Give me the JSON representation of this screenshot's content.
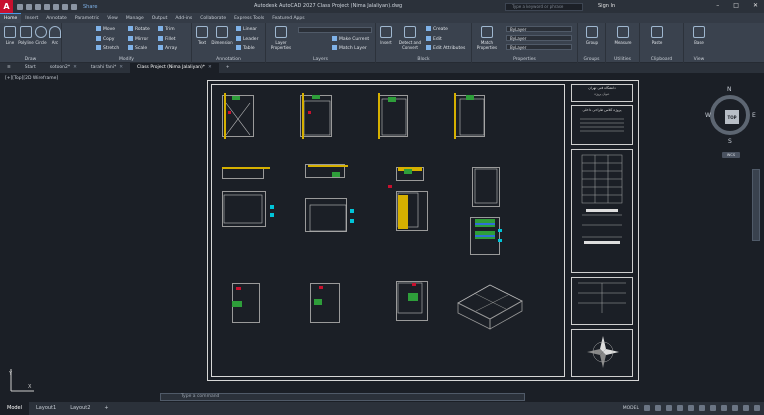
{
  "app": {
    "title": "Autodesk AutoCAD 2027   Class Project (Nima Jalaliyan).dwg",
    "logo": "A",
    "share": "Share",
    "search_placeholder": "Type a keyword or phrase",
    "signin": "Sign In"
  },
  "ribbon_tabs": [
    "Home",
    "Insert",
    "Annotate",
    "Parametric",
    "View",
    "Manage",
    "Output",
    "Add-ins",
    "Collaborate",
    "Express Tools",
    "Featured Apps"
  ],
  "panels": {
    "draw": {
      "title": "Draw",
      "tools": [
        "Line",
        "Polyline",
        "Circle",
        "Arc"
      ]
    },
    "modify": {
      "title": "Modify",
      "tools": [
        "Move",
        "Rotate",
        "Trim",
        "Copy",
        "Mirror",
        "Fillet",
        "Stretch",
        "Scale",
        "Array"
      ]
    },
    "annotation": {
      "title": "Annotation",
      "tools": [
        "Text",
        "Dimension",
        "Linear",
        "Leader",
        "Table"
      ]
    },
    "layers": {
      "title": "Layers",
      "tools": [
        "Layer Properties",
        "Make Current",
        "Match Layer"
      ]
    },
    "block": {
      "title": "Block",
      "tools": [
        "Insert",
        "Detect and Convert",
        "Create",
        "Edit",
        "Edit Attributes"
      ]
    },
    "properties": {
      "title": "Properties",
      "tools": [
        "Match Properties",
        "ByLayer",
        "ByLayer",
        "ByLayer"
      ]
    },
    "groups": {
      "title": "Groups",
      "tools": [
        "Group"
      ]
    },
    "utilities": {
      "title": "Utilities",
      "tools": [
        "Measure"
      ]
    },
    "clipboard": {
      "title": "Clipboard",
      "tools": [
        "Paste"
      ]
    },
    "view": {
      "title": "View",
      "tools": [
        "Base"
      ]
    }
  },
  "doc_tabs": [
    "Start",
    "sotoon2*",
    "tarahi fani*",
    "Class Project (Nima Jalaliyan)*"
  ],
  "viewport": {
    "label": "[+][Top][2D Wireframe]",
    "viewcube": {
      "top": "TOP",
      "n": "N",
      "s": "S",
      "e": "E",
      "w": "W"
    },
    "wcs": "WCS"
  },
  "command": {
    "placeholder": "Type a command"
  },
  "layout_tabs": [
    "Model",
    "Layout1",
    "Layout2"
  ],
  "status": {
    "mode": "MODEL"
  },
  "titleblock": {
    "header": "دانشگاه فنی تهران",
    "subtitle": "عنوان پروژه",
    "project": "پروژه کلاس طراحی داخلی"
  },
  "colors": {
    "accent": "#4c9be8",
    "brand": "#c8102e",
    "background": "#1b1f26"
  }
}
